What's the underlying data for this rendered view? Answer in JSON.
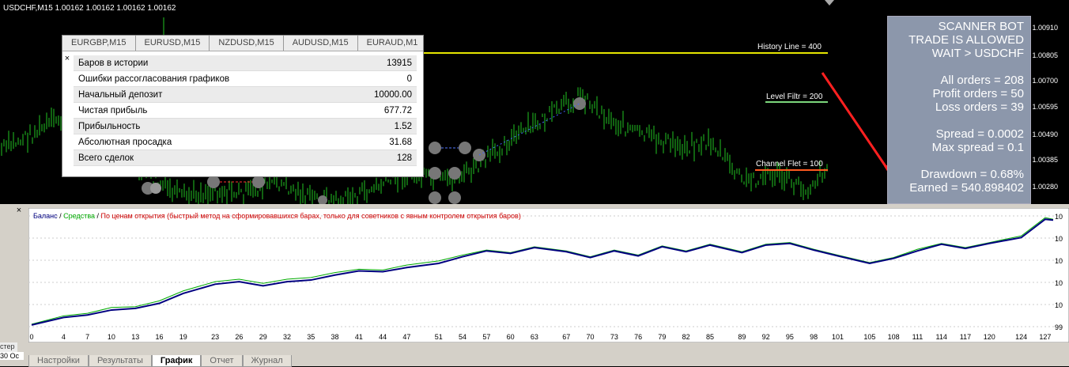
{
  "main_chart": {
    "symbol_title": "USDCHF,M15  1.00162 1.00162 1.00162 1.00162",
    "price_labels": [
      "1.00910",
      "1.00805",
      "1.00700",
      "1.00595",
      "1.00490",
      "1.00385",
      "1.00280"
    ],
    "lines": {
      "history": "History Line = 400",
      "level": "Level Filtr = 200",
      "channel": "Channel Flet = 100"
    },
    "colors": {
      "candles": "#22c422",
      "history_line": "#e6e600",
      "level_line": "#7cd77c",
      "channel_line": "#ff5a1f",
      "arrow": "#ff2020"
    }
  },
  "stats_window": {
    "tabs": [
      "EURGBP,M15",
      "EURUSD,M15",
      "NZDUSD,M15",
      "AUDUSD,M15",
      "EURAUD,M1"
    ],
    "close": "×",
    "rows": [
      {
        "label": "Баров в истории",
        "value": "13915"
      },
      {
        "label": "Ошибки рассогласования графиков",
        "value": "0"
      },
      {
        "label": "Начальный депозит",
        "value": "10000.00"
      },
      {
        "label": "Чистая прибыль",
        "value": "677.72"
      },
      {
        "label": "Прибыльность",
        "value": "1.52"
      },
      {
        "label": "Абсолютная просадка",
        "value": "31.68"
      },
      {
        "label": "Всего сделок",
        "value": "128"
      }
    ]
  },
  "scanner_panel": {
    "lines": [
      "SCANNER BOT",
      "TRADE IS ALLOWED",
      "WAIT > USDCHF",
      "",
      "All orders = 208",
      "Profit orders = 50",
      "Loss orders = 39",
      "",
      "Spread =  0.0002",
      "Max spread =  0.1",
      "",
      "Drawdown  = 0.68%",
      "Earned = 540.898402"
    ]
  },
  "tester": {
    "close": "×",
    "legend": {
      "balance": "Баланс",
      "sep1": " / ",
      "equity": "Средства",
      "sep2": " / ",
      "mode": "По ценам открытия (быстрый метод на сформировавшихся барах, только для советников с явным контролем открытия баров)"
    },
    "vertical_tab": "стер",
    "date_label": "30 Oc",
    "x_ticks": [
      "0",
      "4",
      "7",
      "10",
      "13",
      "16",
      "19",
      "23",
      "26",
      "29",
      "32",
      "35",
      "38",
      "41",
      "44",
      "47",
      "51",
      "54",
      "57",
      "60",
      "63",
      "67",
      "70",
      "73",
      "76",
      "79",
      "82",
      "85",
      "89",
      "92",
      "95",
      "98",
      "101",
      "105",
      "108",
      "111",
      "114",
      "117",
      "120",
      "124",
      "127"
    ],
    "right_ticks": [
      "10",
      "10",
      "10",
      "10",
      "10",
      "99"
    ],
    "bottom_tabs": [
      "Настройки",
      "Результаты",
      "График",
      "Отчет",
      "Журнал"
    ],
    "active_tab": "График",
    "colors": {
      "balance": "#000080",
      "equity": "#00aa00",
      "mode": "#cc0000"
    }
  },
  "chart_data": {
    "type": "line",
    "x": [
      0,
      4,
      7,
      10,
      13,
      16,
      19,
      23,
      26,
      29,
      32,
      35,
      38,
      41,
      44,
      47,
      51,
      54,
      57,
      60,
      63,
      67,
      70,
      73,
      76,
      79,
      82,
      85,
      89,
      92,
      95,
      98,
      101,
      105,
      108,
      111,
      114,
      117,
      120,
      124,
      127,
      128
    ],
    "series": [
      {
        "name": "Баланс",
        "values": [
          6,
          15,
          18,
          24,
          26,
          32,
          44,
          55,
          58,
          53,
          58,
          60,
          66,
          71,
          70,
          75,
          80,
          88,
          95,
          92,
          99,
          94,
          87,
          95,
          89,
          100,
          94,
          102,
          93,
          102,
          104,
          96,
          89,
          80,
          86,
          95,
          103,
          98,
          104,
          111,
          133,
          132
        ]
      },
      {
        "name": "Средства",
        "values": [
          7,
          17,
          20,
          27,
          28,
          35,
          47,
          58,
          61,
          56,
          61,
          63,
          69,
          73,
          72,
          78,
          83,
          90,
          96,
          93,
          100,
          95,
          88,
          96,
          90,
          101,
          95,
          103,
          94,
          103,
          105,
          97,
          90,
          81,
          87,
          97,
          104,
          99,
          105,
          113,
          135,
          133
        ]
      }
    ],
    "xlabel": "",
    "ylabel": ""
  }
}
